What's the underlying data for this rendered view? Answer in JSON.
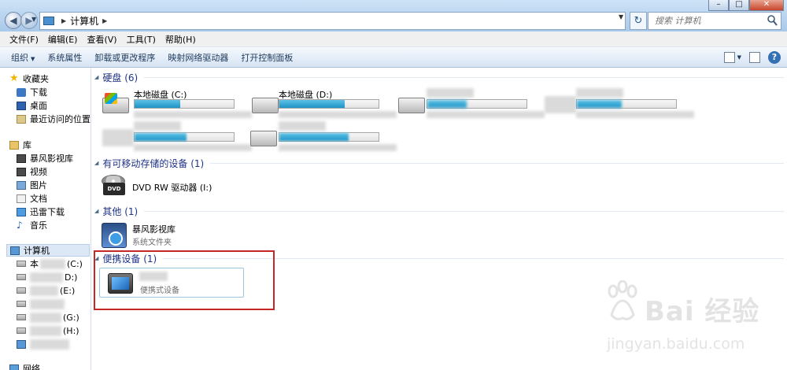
{
  "window": {
    "breadcrumb": "计算机",
    "search_placeholder": "搜索 计算机"
  },
  "menu": [
    "文件(F)",
    "编辑(E)",
    "查看(V)",
    "工具(T)",
    "帮助(H)"
  ],
  "toolbar": {
    "organize": "组织",
    "system_properties": "系统属性",
    "uninstall": "卸载或更改程序",
    "map_drive": "映射网络驱动器",
    "control_panel": "打开控制面板"
  },
  "nav": {
    "favorites": "收藏夹",
    "downloads": "下载",
    "desktop": "桌面",
    "recent": "最近访问的位置",
    "libraries": "库",
    "storm_library": "暴风影视库",
    "videos": "视频",
    "pictures": "图片",
    "documents": "文档",
    "thunder": "迅雷下载",
    "music": "音乐",
    "computer": "计算机",
    "drive_c_prefix": "本",
    "drive_c_suffix": "(C:)",
    "drive_d": "D:)",
    "drive_e": "(E:)",
    "drive_g": "(G:)",
    "drive_h": "(H:)",
    "network": "网络"
  },
  "groups": {
    "hard_disks": "硬盘 (6)",
    "removable": "有可移动存储的设备 (1)",
    "other": "其他 (1)",
    "portable": "便携设备 (1)"
  },
  "drives": [
    {
      "name": "本地磁盘 (C:)",
      "used_fraction": 0.46
    },
    {
      "name": "本地磁盘 (D:)",
      "used_fraction": 0.66
    }
  ],
  "removable_item": {
    "name": "DVD RW 驱动器 (I:)",
    "icon": "dvd-drive-icon"
  },
  "other_item": {
    "name": "暴风影视库",
    "subtitle": "系统文件夹",
    "icon": "media-library-icon"
  },
  "portable_item": {
    "subtitle": "便携式设备",
    "icon": "portable-device-icon"
  },
  "watermark": {
    "brand": "Bai 经验",
    "url": "jingyan.baidu.com"
  },
  "colors": {
    "highlight": "#c62828",
    "group_header": "#1e3287",
    "usage_bar": "#1c94c7"
  }
}
